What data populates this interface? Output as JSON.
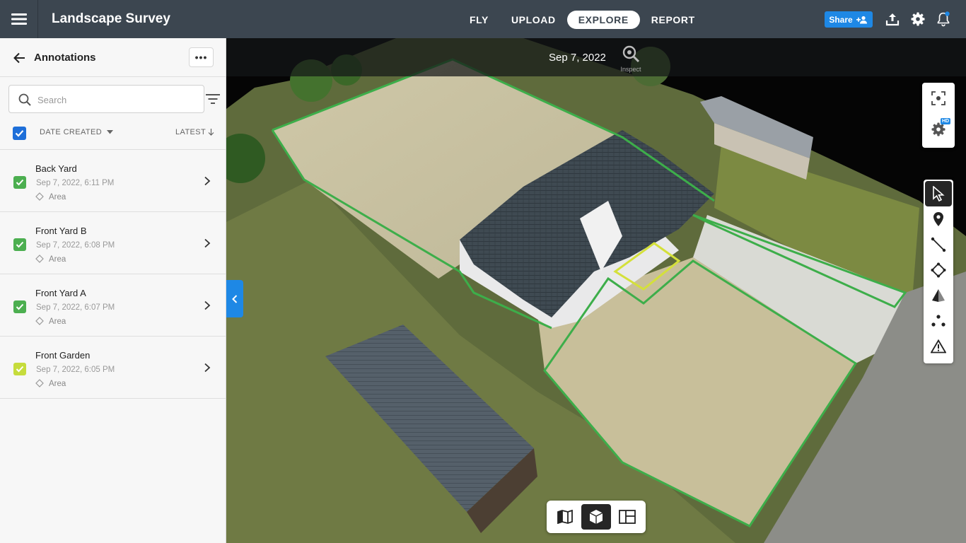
{
  "app": {
    "title": "Landscape Survey"
  },
  "nav": {
    "items": [
      "FLY",
      "UPLOAD",
      "EXPLORE",
      "REPORT"
    ],
    "active": "EXPLORE"
  },
  "header_actions": {
    "share_label": "Share"
  },
  "sidebar": {
    "title": "Annotations",
    "more_label": "•••",
    "search": {
      "placeholder": "Search",
      "value": ""
    },
    "sort": {
      "field": "DATE CREATED",
      "order": "LATEST"
    },
    "items": [
      {
        "title": "Back Yard",
        "date": "Sep 7, 2022, 6:11 PM",
        "type": "Area",
        "color": "#4caf50"
      },
      {
        "title": "Front Yard B",
        "date": "Sep 7, 2022, 6:08 PM",
        "type": "Area",
        "color": "#4caf50"
      },
      {
        "title": "Front Yard A",
        "date": "Sep 7, 2022, 6:07 PM",
        "type": "Area",
        "color": "#4caf50"
      },
      {
        "title": "Front Garden",
        "date": "Sep 7, 2022, 6:05 PM",
        "type": "Area",
        "color": "#c6dc3c"
      }
    ]
  },
  "viewport": {
    "capture_date": "Sep 7, 2022",
    "inspect_label": "Inspect",
    "hd_badge": "HD",
    "area_outline_color": "#3dae4a",
    "garden_outline_color": "#d4e03a",
    "active_tool": "select",
    "view_mode": "3d"
  },
  "colors": {
    "topbar": "#3c4650",
    "accent": "#1e88e5"
  }
}
